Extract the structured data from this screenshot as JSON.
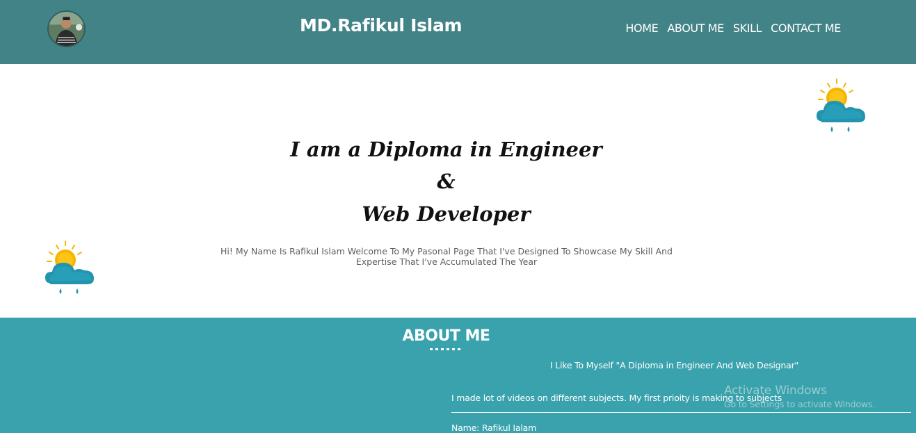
{
  "header": {
    "brand": "MD.Rafikul Islam",
    "nav": [
      "HOME",
      "ABOUT ME",
      "SKILL",
      "CONTACT ME"
    ]
  },
  "hero": {
    "title_line1": "I am a Diploma in Engineer",
    "title_line2": "&",
    "title_line3": "Web Developer",
    "description": "Hi! My Name Is Rafikul Islam Welcome To My Pasonal Page That I've Designed To Showcase My Skill And Expertise That I've Accumulated The Year"
  },
  "about": {
    "title": "ABOUT ME",
    "quote": "I Like To Myself \"A Diploma in Engineer And Web Designar\"",
    "paragraph": "I made lot of videos on different subjects. My first prioity is making to subjects",
    "name": "Name: Rafikul Ialam"
  },
  "watermark": {
    "title": "Activate Windows",
    "subtitle": "Go to Settings to activate Windows."
  },
  "colors": {
    "header_bg": "#428388",
    "about_bg": "#39a2ac",
    "sun": "#f7b500",
    "cloud": "#2394ad"
  }
}
